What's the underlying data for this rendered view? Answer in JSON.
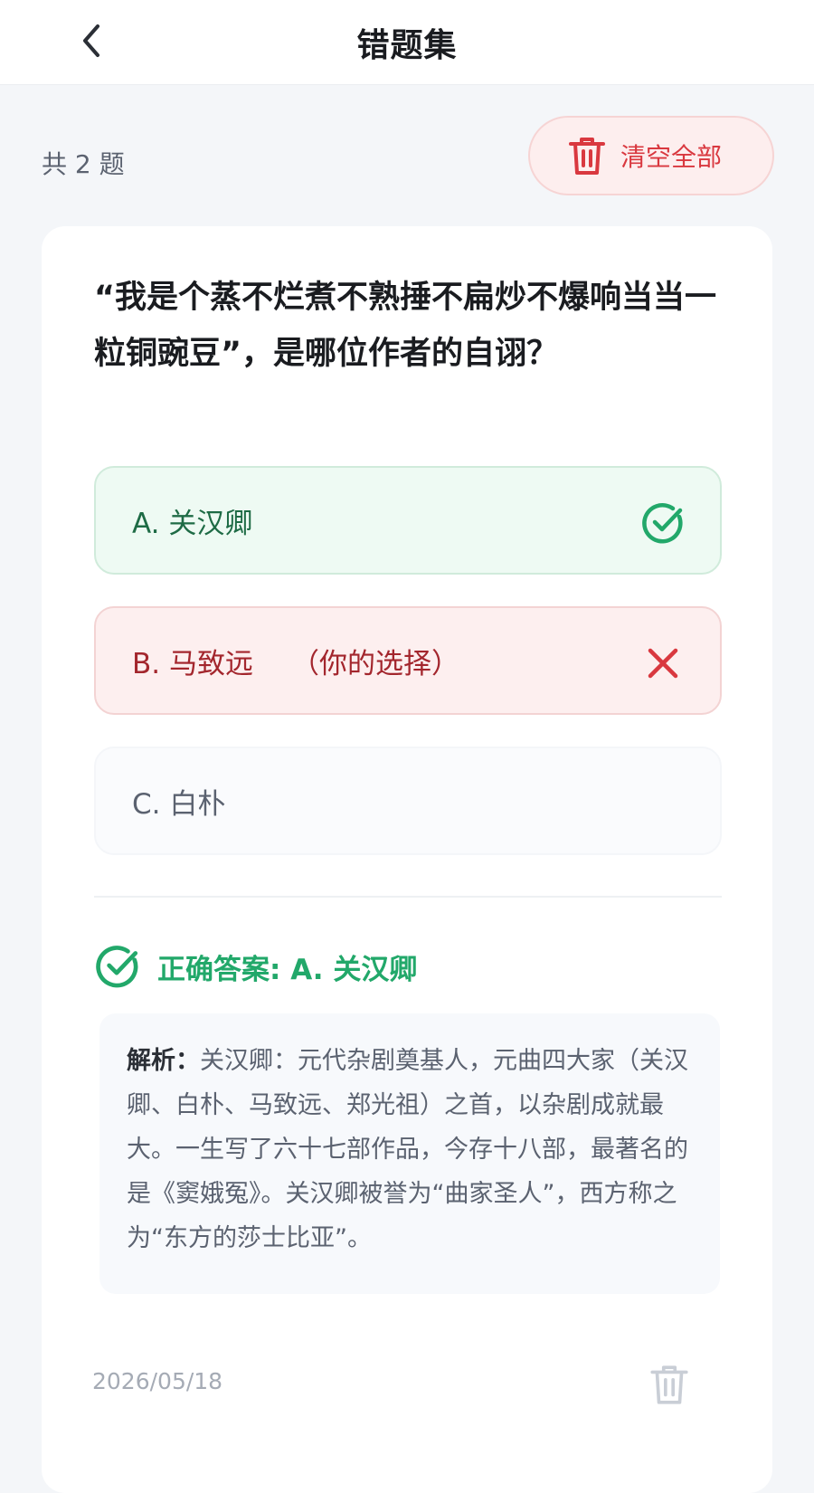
{
  "header": {
    "title": "错题集",
    "back_icon": "chevron-left-icon"
  },
  "summary": {
    "count_text": "共 2 题",
    "clear_all_label": "清空全部",
    "clear_icon": "trash-icon"
  },
  "question": {
    "text": "“我是个蒸不烂煮不熟捶不扁炒不爆响当当一粒铜豌豆”，是哪位作者的自诩？",
    "options": [
      {
        "label": "A. 关汉卿",
        "state": "correct",
        "status_icon": "check-circle-icon"
      },
      {
        "label": "B. 马致远",
        "note": "（你的选择）",
        "state": "wrong",
        "status_icon": "close-icon"
      },
      {
        "label": "C. 白朴",
        "state": "neutral"
      }
    ],
    "correct_answer_text": "正确答案: A. 关汉卿",
    "analysis_label": "解析：",
    "analysis_text": "关汉卿：元代杂剧奠基人，元曲四大家（关汉卿、白朴、马致远、郑光祖）之首，以杂剧成就最大。一生写了六十七部作品，今存十八部，最著名的是《窦娥冤》。关汉卿被誉为“曲家圣人”，西方称之为“东方的莎士比亚”。",
    "date": "2026/05/18",
    "delete_icon": "trash-icon"
  },
  "colors": {
    "correct": "#22a86a",
    "wrong": "#d9383f",
    "background": "#f4f6f9"
  }
}
